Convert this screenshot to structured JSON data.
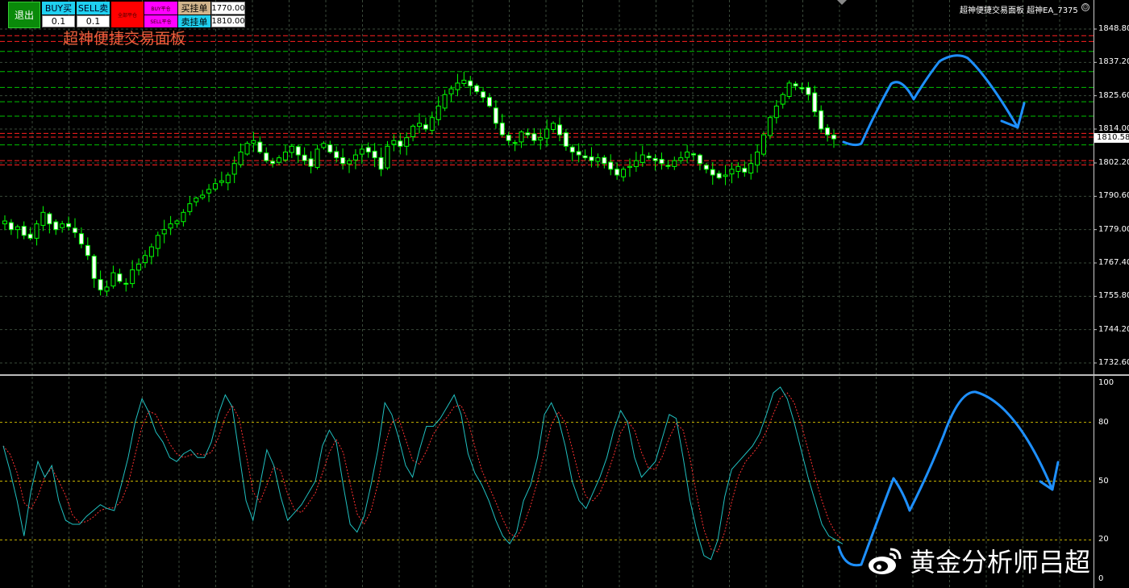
{
  "panel": {
    "exit_label": "退出",
    "buy_label": "BUY买",
    "sell_label": "SELL卖",
    "buy_lot": "0.1",
    "sell_lot": "0.1",
    "close_all_label": "全部平仓",
    "buy_close_label": "BUY平仓",
    "sell_close_label": "SELL平仓",
    "buy_limit_label": "买挂单",
    "sell_limit_label": "卖挂单",
    "buy_limit_price": "1770.00",
    "sell_limit_price": "1810.00",
    "title": "超神便捷交易面板"
  },
  "header": {
    "ea_label": "超神便捷交易面板 超神EA_7375"
  },
  "price_axis": {
    "ticks": [
      "1848.80",
      "1837.20",
      "1825.60",
      "1814.00",
      "1802.20",
      "1790.60",
      "1779.00",
      "1767.40",
      "1755.80",
      "1744.20",
      "1732.60"
    ],
    "current_price": "1810.58"
  },
  "oscillator_axis": {
    "ticks": [
      "100",
      "80",
      "50",
      "20",
      "0"
    ],
    "levels": [
      80,
      50,
      20
    ]
  },
  "colors": {
    "background": "#000000",
    "candle": "#00ff00",
    "grid": "#3a4a3a",
    "resistance_line": "#ff2020",
    "support_line": "#00c000",
    "osc_main": "#20c0c0",
    "osc_signal": "#ff3030",
    "annotation": "#1e90ff",
    "level_line": "#c8b400"
  },
  "watermark": {
    "text": "黄金分析师吕超",
    "icon": "weibo-icon"
  },
  "chart_data": [
    {
      "type": "candlestick",
      "title": "",
      "ylim": [
        1732.6,
        1848.8
      ],
      "closes": [
        1782,
        1779,
        1780,
        1777,
        1776,
        1781,
        1785,
        1781,
        1779,
        1781,
        1780,
        1778,
        1774,
        1770,
        1762,
        1758,
        1759,
        1764,
        1761,
        1760,
        1765,
        1767,
        1770,
        1773,
        1777,
        1779,
        1781,
        1782,
        1785,
        1788,
        1790,
        1791,
        1793,
        1795,
        1796,
        1798,
        1802,
        1806,
        1809,
        1810,
        1806,
        1803,
        1802,
        1804,
        1806,
        1808,
        1805,
        1803,
        1801,
        1807,
        1809,
        1806,
        1804,
        1802,
        1803,
        1805,
        1807,
        1806,
        1804,
        1800,
        1808,
        1810,
        1808,
        1811,
        1815,
        1816,
        1814,
        1818,
        1822,
        1826,
        1828,
        1830,
        1831,
        1829,
        1827,
        1825,
        1822,
        1816,
        1812,
        1810,
        1809,
        1813,
        1812,
        1810,
        1811,
        1814,
        1816,
        1812,
        1808,
        1806,
        1805,
        1804,
        1803,
        1804,
        1802,
        1800,
        1798,
        1800,
        1801,
        1803,
        1805,
        1804,
        1803,
        1802,
        1801,
        1803,
        1804,
        1806,
        1805,
        1802,
        1800,
        1798,
        1797,
        1798,
        1800,
        1801,
        1799,
        1802,
        1806,
        1812,
        1818,
        1822,
        1826,
        1830,
        1829,
        1828,
        1826,
        1820,
        1814,
        1812,
        1810.58
      ]
    },
    {
      "type": "line",
      "title": "",
      "ylim": [
        0,
        100
      ],
      "series": [
        {
          "values": [
            68,
            55,
            40,
            22,
            45,
            60,
            52,
            58,
            40,
            30,
            28,
            28,
            32,
            35,
            38,
            36,
            35,
            48,
            62,
            80,
            92,
            85,
            75,
            70,
            62,
            60,
            64,
            66,
            62,
            62,
            70,
            84,
            94,
            88,
            64,
            40,
            30,
            48,
            66,
            58,
            42,
            30,
            34,
            38,
            44,
            50,
            68,
            76,
            70,
            48,
            28,
            24,
            32,
            48,
            66,
            90,
            84,
            72,
            58,
            52,
            66,
            78,
            78,
            82,
            88,
            94,
            84,
            64,
            54,
            48,
            40,
            30,
            22,
            18,
            24,
            40,
            48,
            62,
            84,
            90,
            82,
            68,
            50,
            40,
            36,
            44,
            52,
            62,
            76,
            86,
            80,
            62,
            52,
            56,
            60,
            72,
            84,
            82,
            62,
            40,
            24,
            12,
            10,
            20,
            42,
            56,
            60,
            64,
            68,
            74,
            84,
            95,
            98,
            92,
            80,
            66,
            52,
            40,
            28,
            22,
            20,
            18
          ]
        }
      ]
    }
  ]
}
